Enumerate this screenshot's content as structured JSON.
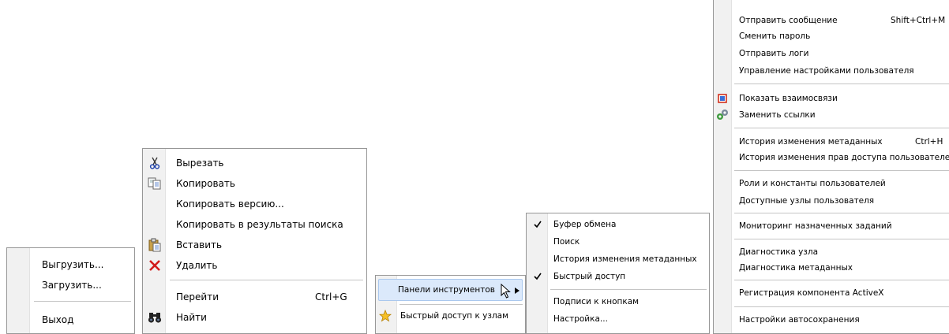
{
  "menu_file": {
    "items": [
      "Выгрузить...",
      "Загрузить...",
      "Выход"
    ]
  },
  "menu_edit": {
    "cut": "Вырезать",
    "copy": "Копировать",
    "copy_version": "Копировать версию...",
    "copy_to_search": "Копировать в результаты поиска",
    "paste": "Вставить",
    "delete": "Удалить",
    "goto": "Перейти",
    "goto_shortcut": "Ctrl+G",
    "find": "Найти"
  },
  "menu_view": {
    "toolbars": "Панели инструментов",
    "quick_access": "Быстрый доступ к узлам"
  },
  "menu_toolbars": {
    "clipboard": "Буфер обмена",
    "search": "Поиск",
    "history": "История изменения метаданных",
    "quick": "Быстрый доступ",
    "captions": "Подписи к кнопкам",
    "settings": "Настройка..."
  },
  "menu_tools": {
    "send_message": "Отправить сообщение",
    "send_message_shortcut": "Shift+Ctrl+M",
    "change_password": "Сменить пароль",
    "send_logs": "Отправить логи",
    "user_settings": "Управление настройками пользователя",
    "show_relations": "Показать взаимосвязи",
    "replace_links": "Заменить ссылки",
    "metadata_history": "История изменения метаданных",
    "metadata_history_shortcut": "Ctrl+H",
    "access_history": "История изменения прав доступа пользователей",
    "roles_constants": "Роли и константы пользователей",
    "available_nodes": "Доступные узлы пользователя",
    "task_monitoring": "Мониторинг назначенных заданий",
    "node_diagnostics": "Диагностика узла",
    "metadata_diagnostics": "Диагностика метаданных",
    "activex_registration": "Регистрация компонента ActiveX",
    "autosave_settings": "Настройки автосохранения"
  },
  "colors": {
    "highlight": "#dbe9fb",
    "highlight_border": "#aac8ee",
    "delete_red": "#d21b1b"
  }
}
